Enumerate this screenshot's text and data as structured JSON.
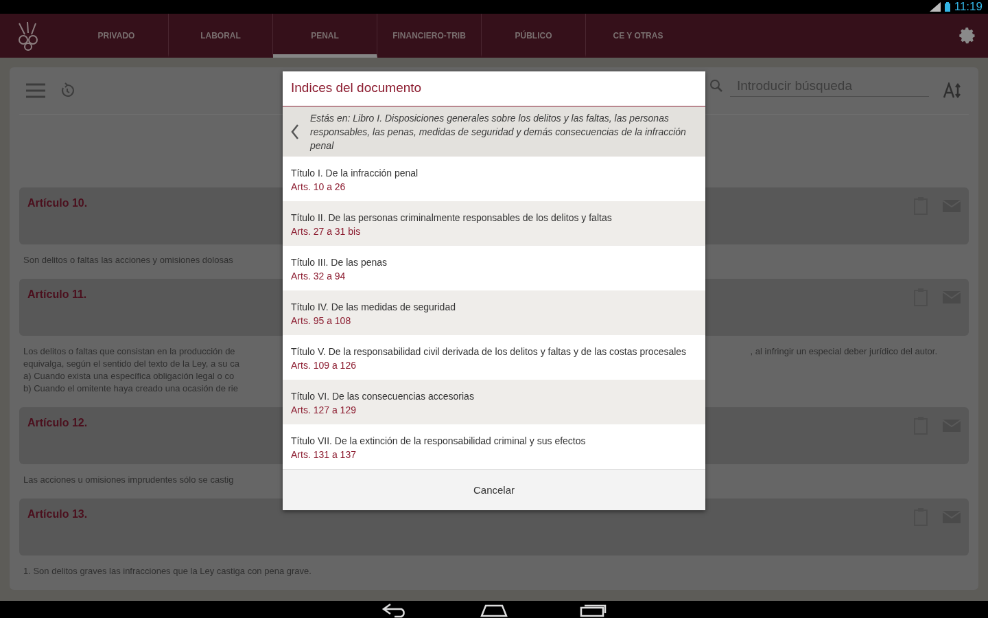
{
  "status_bar": {
    "time": "11:19"
  },
  "tabs": [
    {
      "label": "PRIVADO",
      "selected": false
    },
    {
      "label": "LABORAL",
      "selected": false
    },
    {
      "label": "PENAL",
      "selected": true
    },
    {
      "label": "FINANCIERO-TRIB",
      "selected": false
    },
    {
      "label": "PÚBLICO",
      "selected": false
    },
    {
      "label": "CE Y OTRAS",
      "selected": false
    }
  ],
  "search": {
    "placeholder": "Introducir búsqueda"
  },
  "articles": [
    {
      "title": "Artículo 10.",
      "body": [
        {
          "left": "Son delitos o faltas las acciones y omisiones dolosas"
        }
      ]
    },
    {
      "title": "Artículo 11.",
      "body": [
        {
          "left": "Los delitos o faltas que consistan en la producción de",
          "right": ", al infringir un especial deber jurídico del autor."
        },
        {
          "left": "equivalga, según el sentido del texto de la Ley, a su ca"
        },
        {
          "left": "a) Cuando exista una específica obligación legal o co"
        },
        {
          "left": "b) Cuando el omitente haya creado una ocasión de rie"
        }
      ]
    },
    {
      "title": "Artículo 12.",
      "body": [
        {
          "left": "Las acciones u omisiones imprudentes sólo se castig"
        }
      ]
    },
    {
      "title": "Artículo 13.",
      "body": [
        {
          "left": "1. Son delitos graves las infracciones que la Ley castiga con pena grave."
        }
      ]
    }
  ],
  "dialog": {
    "title": "Indices del documento",
    "breadcrumb": "Estás en: Libro I. Disposiciones generales sobre los delitos y las faltas, las personas responsables, las penas, medidas de seguridad y demás consecuencias de la infracción penal",
    "items": [
      {
        "title": "Título I. De la infracción penal",
        "range": "Arts. 10 a 26"
      },
      {
        "title": "Título II. De las personas criminalmente responsables de los delitos y faltas",
        "range": "Arts. 27 a 31 bis"
      },
      {
        "title": "Título III. De las penas",
        "range": "Arts. 32 a 94"
      },
      {
        "title": "Título IV. De las medidas de seguridad",
        "range": "Arts. 95 a 108"
      },
      {
        "title": "Título V. De la responsabilidad civil derivada de los delitos y faltas y de las costas procesales",
        "range": "Arts. 109 a 126"
      },
      {
        "title": "Título VI. De las consecuencias accesorias",
        "range": "Arts. 127 a 129"
      },
      {
        "title": "Título VII. De la extinción de la responsabilidad criminal y sus efectos",
        "range": "Arts. 131 a 137"
      }
    ],
    "cancel": "Cancelar"
  }
}
